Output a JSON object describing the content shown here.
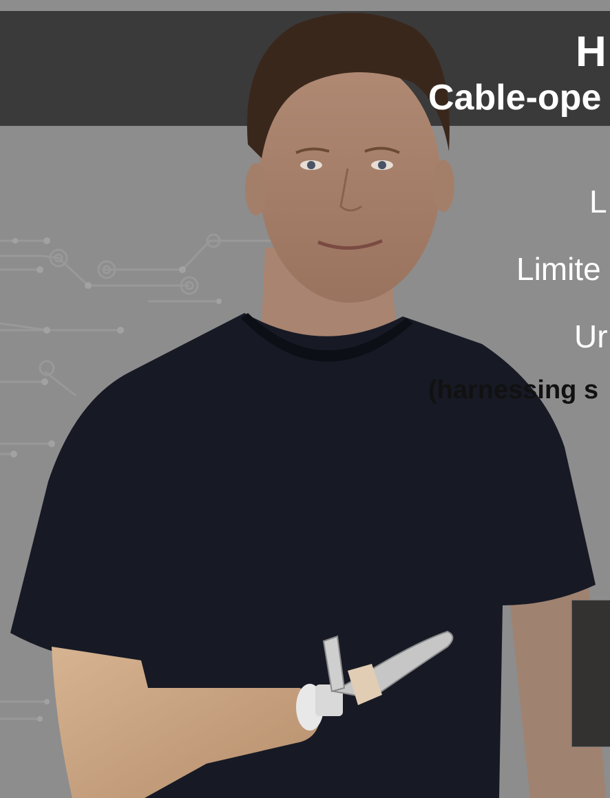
{
  "slide": {
    "title": "H",
    "subtitle": "Cable-ope",
    "bullets": [
      "L",
      "Limite",
      "Ur"
    ],
    "note": "(harnessing s"
  },
  "colors": {
    "background": "#8d8d8d",
    "title_band": "#3a3a3a",
    "text": "#ffffff",
    "note_text": "#111111",
    "shirt": "#171a25",
    "prosthetic_liner": "#cfa985",
    "hook": "#c6c6c6"
  }
}
